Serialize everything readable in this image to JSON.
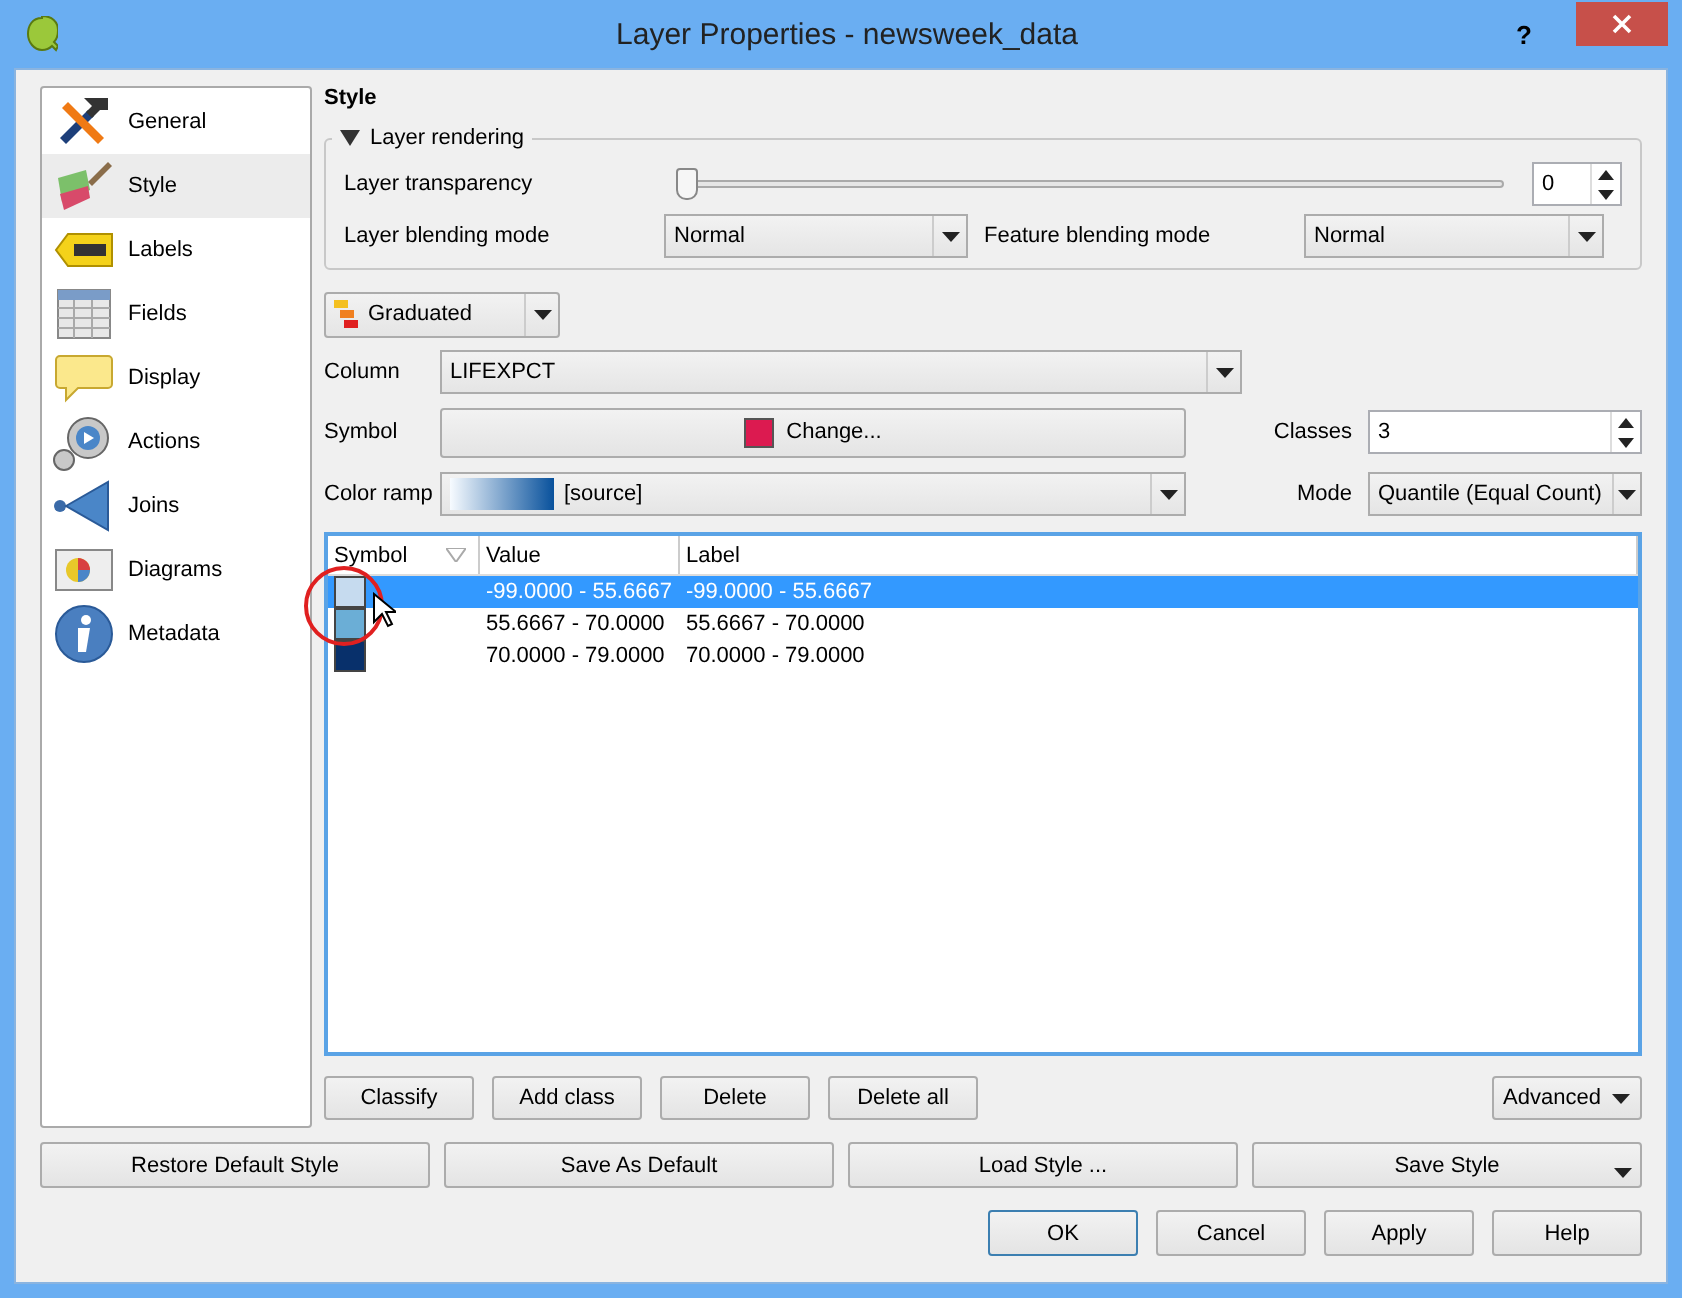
{
  "window": {
    "title": "Layer Properties - newsweek_data",
    "help": "?"
  },
  "sidebar": {
    "items": [
      {
        "label": "General",
        "selected": false
      },
      {
        "label": "Style",
        "selected": true
      },
      {
        "label": "Labels",
        "selected": false
      },
      {
        "label": "Fields",
        "selected": false
      },
      {
        "label": "Display",
        "selected": false
      },
      {
        "label": "Actions",
        "selected": false
      },
      {
        "label": "Joins",
        "selected": false
      },
      {
        "label": "Diagrams",
        "selected": false
      },
      {
        "label": "Metadata",
        "selected": false
      }
    ]
  },
  "style": {
    "heading": "Style",
    "layer_rendering": {
      "title": "Layer rendering",
      "expanded": true,
      "transparency_label": "Layer transparency",
      "transparency": {
        "level": 0,
        "value": "0"
      },
      "layer_blending_label": "Layer blending mode",
      "layer_blending": "Normal",
      "feature_blending_label": "Feature blending mode",
      "feature_blending": "Normal"
    },
    "renderer": "Graduated",
    "column_label": "Column",
    "column": "LIFEXPCT",
    "symbol_label": "Symbol",
    "symbol_button": "Change...",
    "classes_label": "Classes",
    "classes": "3",
    "color_ramp_label": "Color ramp",
    "color_ramp": "[source]",
    "mode_label": "Mode",
    "mode": "Quantile (Equal Count)"
  },
  "table": {
    "columns": [
      "Symbol",
      "Value",
      "Label"
    ],
    "rows": [
      {
        "color": "#c6dbef",
        "value": "-99.0000 - 55.6667",
        "label": "-99.0000 - 55.6667",
        "selected": true
      },
      {
        "color": "#6baed6",
        "value": "55.6667 - 70.0000",
        "label": "55.6667 - 70.0000",
        "selected": false
      },
      {
        "color": "#08306b",
        "value": "70.0000 - 79.0000",
        "label": "70.0000 - 79.0000",
        "selected": false
      }
    ]
  },
  "class_buttons": [
    "Classify",
    "Add class",
    "Delete",
    "Delete all"
  ],
  "advanced_button": "Advanced",
  "style_buttons": [
    {
      "label": "Restore Default Style",
      "menu": false
    },
    {
      "label": "Save As Default",
      "menu": false
    },
    {
      "label": "Load Style ...",
      "menu": false
    },
    {
      "label": "Save Style",
      "menu": true
    }
  ],
  "dialog_buttons": [
    "OK",
    "Cancel",
    "Apply",
    "Help"
  ]
}
